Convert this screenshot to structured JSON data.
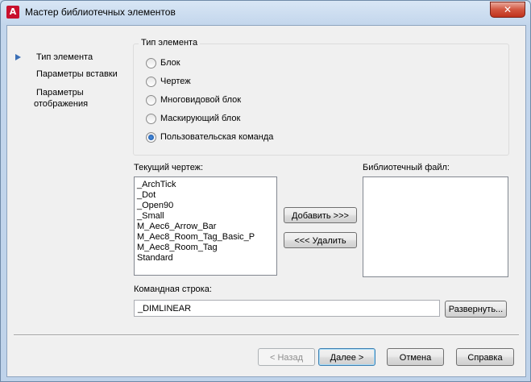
{
  "window": {
    "title": "Мастер библиотечных элементов",
    "app_icon_letter": "A",
    "close_glyph": "✕"
  },
  "nav": {
    "items": [
      {
        "label": "Тип элемента",
        "active": true
      },
      {
        "label": "Параметры вставки"
      },
      {
        "label": "Параметры",
        "label2": "отображения"
      }
    ]
  },
  "element_type": {
    "group_title": "Тип элемента",
    "options": [
      {
        "label": "Блок",
        "checked": false
      },
      {
        "label": "Чертеж",
        "checked": false
      },
      {
        "label": "Многовидовой блок",
        "checked": false
      },
      {
        "label": "Маскирующий блок",
        "checked": false
      },
      {
        "label": "Пользовательская команда",
        "checked": true
      }
    ]
  },
  "current_drawing": {
    "label": "Текущий чертеж:",
    "items": [
      "_ArchTick",
      "_Dot",
      "_Open90",
      "_Small",
      "M_Aec6_Arrow_Bar",
      "M_Aec8_Room_Tag_Basic_P",
      "M_Aec8_Room_Tag",
      "Standard"
    ]
  },
  "library_file": {
    "label": "Библиотечный файл:",
    "items": []
  },
  "actions": {
    "add_label": "Добавить >>>",
    "remove_label": "<<< Удалить"
  },
  "command_line": {
    "label": "Командная строка:",
    "value": "_DIMLINEAR",
    "expand_label": "Развернуть..."
  },
  "footer": {
    "back_label": "< Назад",
    "next_label": "Далее >",
    "cancel_label": "Отмена",
    "help_label": "Справка"
  }
}
